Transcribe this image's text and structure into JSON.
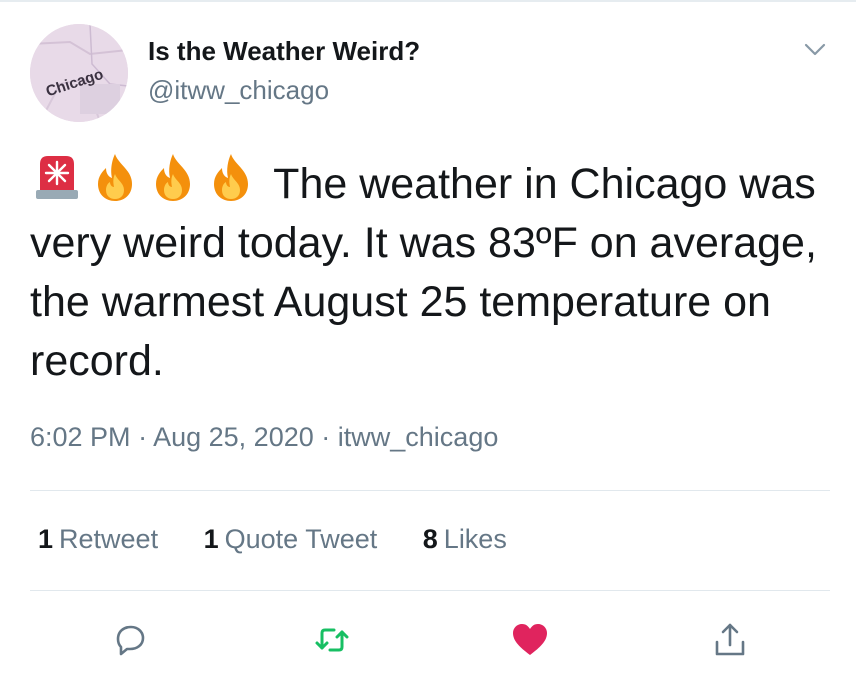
{
  "account": {
    "display_name": "Is the Weather Weird?",
    "handle": "@itww_chicago",
    "avatar_label": "Chicago"
  },
  "tweet": {
    "emojis": [
      "rotating-light-icon",
      "fire-icon",
      "fire-icon",
      "fire-icon"
    ],
    "text": "The weather in Chicago was very weird today. It was 83ºF on average, the warmest August 25 temperature on record.",
    "time": "6:02 PM",
    "sep1": "·",
    "date": "Aug 25, 2020",
    "sep2": "·",
    "source": "itww_chicago"
  },
  "stats": {
    "retweets": {
      "count": "1",
      "label": "Retweet"
    },
    "quotes": {
      "count": "1",
      "label": "Quote Tweet"
    },
    "likes": {
      "count": "8",
      "label": "Likes"
    }
  },
  "colors": {
    "text": "#14171a",
    "secondary": "#657786",
    "retweet_green": "#17bf63",
    "like_red": "#e0245e",
    "divider": "#e1e8ed"
  }
}
